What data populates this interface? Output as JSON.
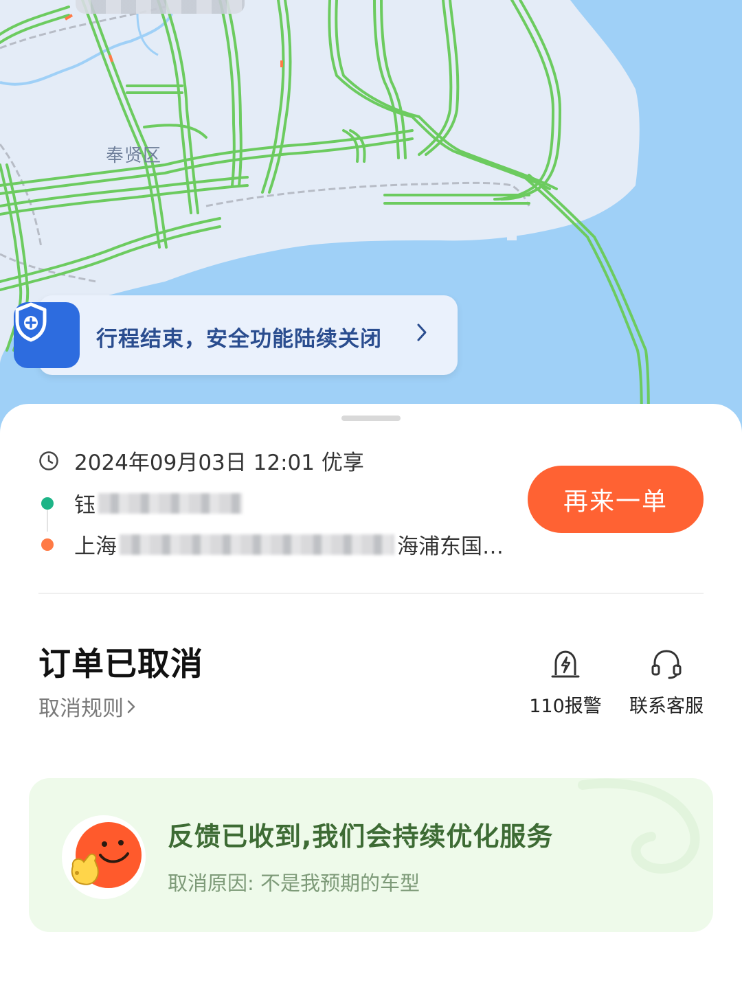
{
  "map": {
    "district_label": "奉贤区",
    "edge_label": "山"
  },
  "safety_banner": {
    "text": "行程结束，安全功能陆续关闭"
  },
  "trip": {
    "datetime_service": "2024年09月03日 12:01 优享",
    "origin_prefix": "钰",
    "destination_prefix": "上海",
    "destination_suffix": "海浦东国…"
  },
  "reorder_button": "再来一单",
  "order": {
    "status_title": "订单已取消",
    "rules_link": "取消规则"
  },
  "actions": {
    "police": "110报警",
    "service": "联系客服"
  },
  "feedback": {
    "title": "反馈已收到,我们会持续优化服务",
    "reason": "取消原因: 不是我预期的车型"
  },
  "colors": {
    "accent_orange": "#ff6233",
    "shield_blue": "#2d6cdf",
    "traffic_green": "#6ccb5f",
    "water_blue": "#9fd0f7",
    "land": "#e4ecf7",
    "feedback_bg": "#eefaea"
  }
}
